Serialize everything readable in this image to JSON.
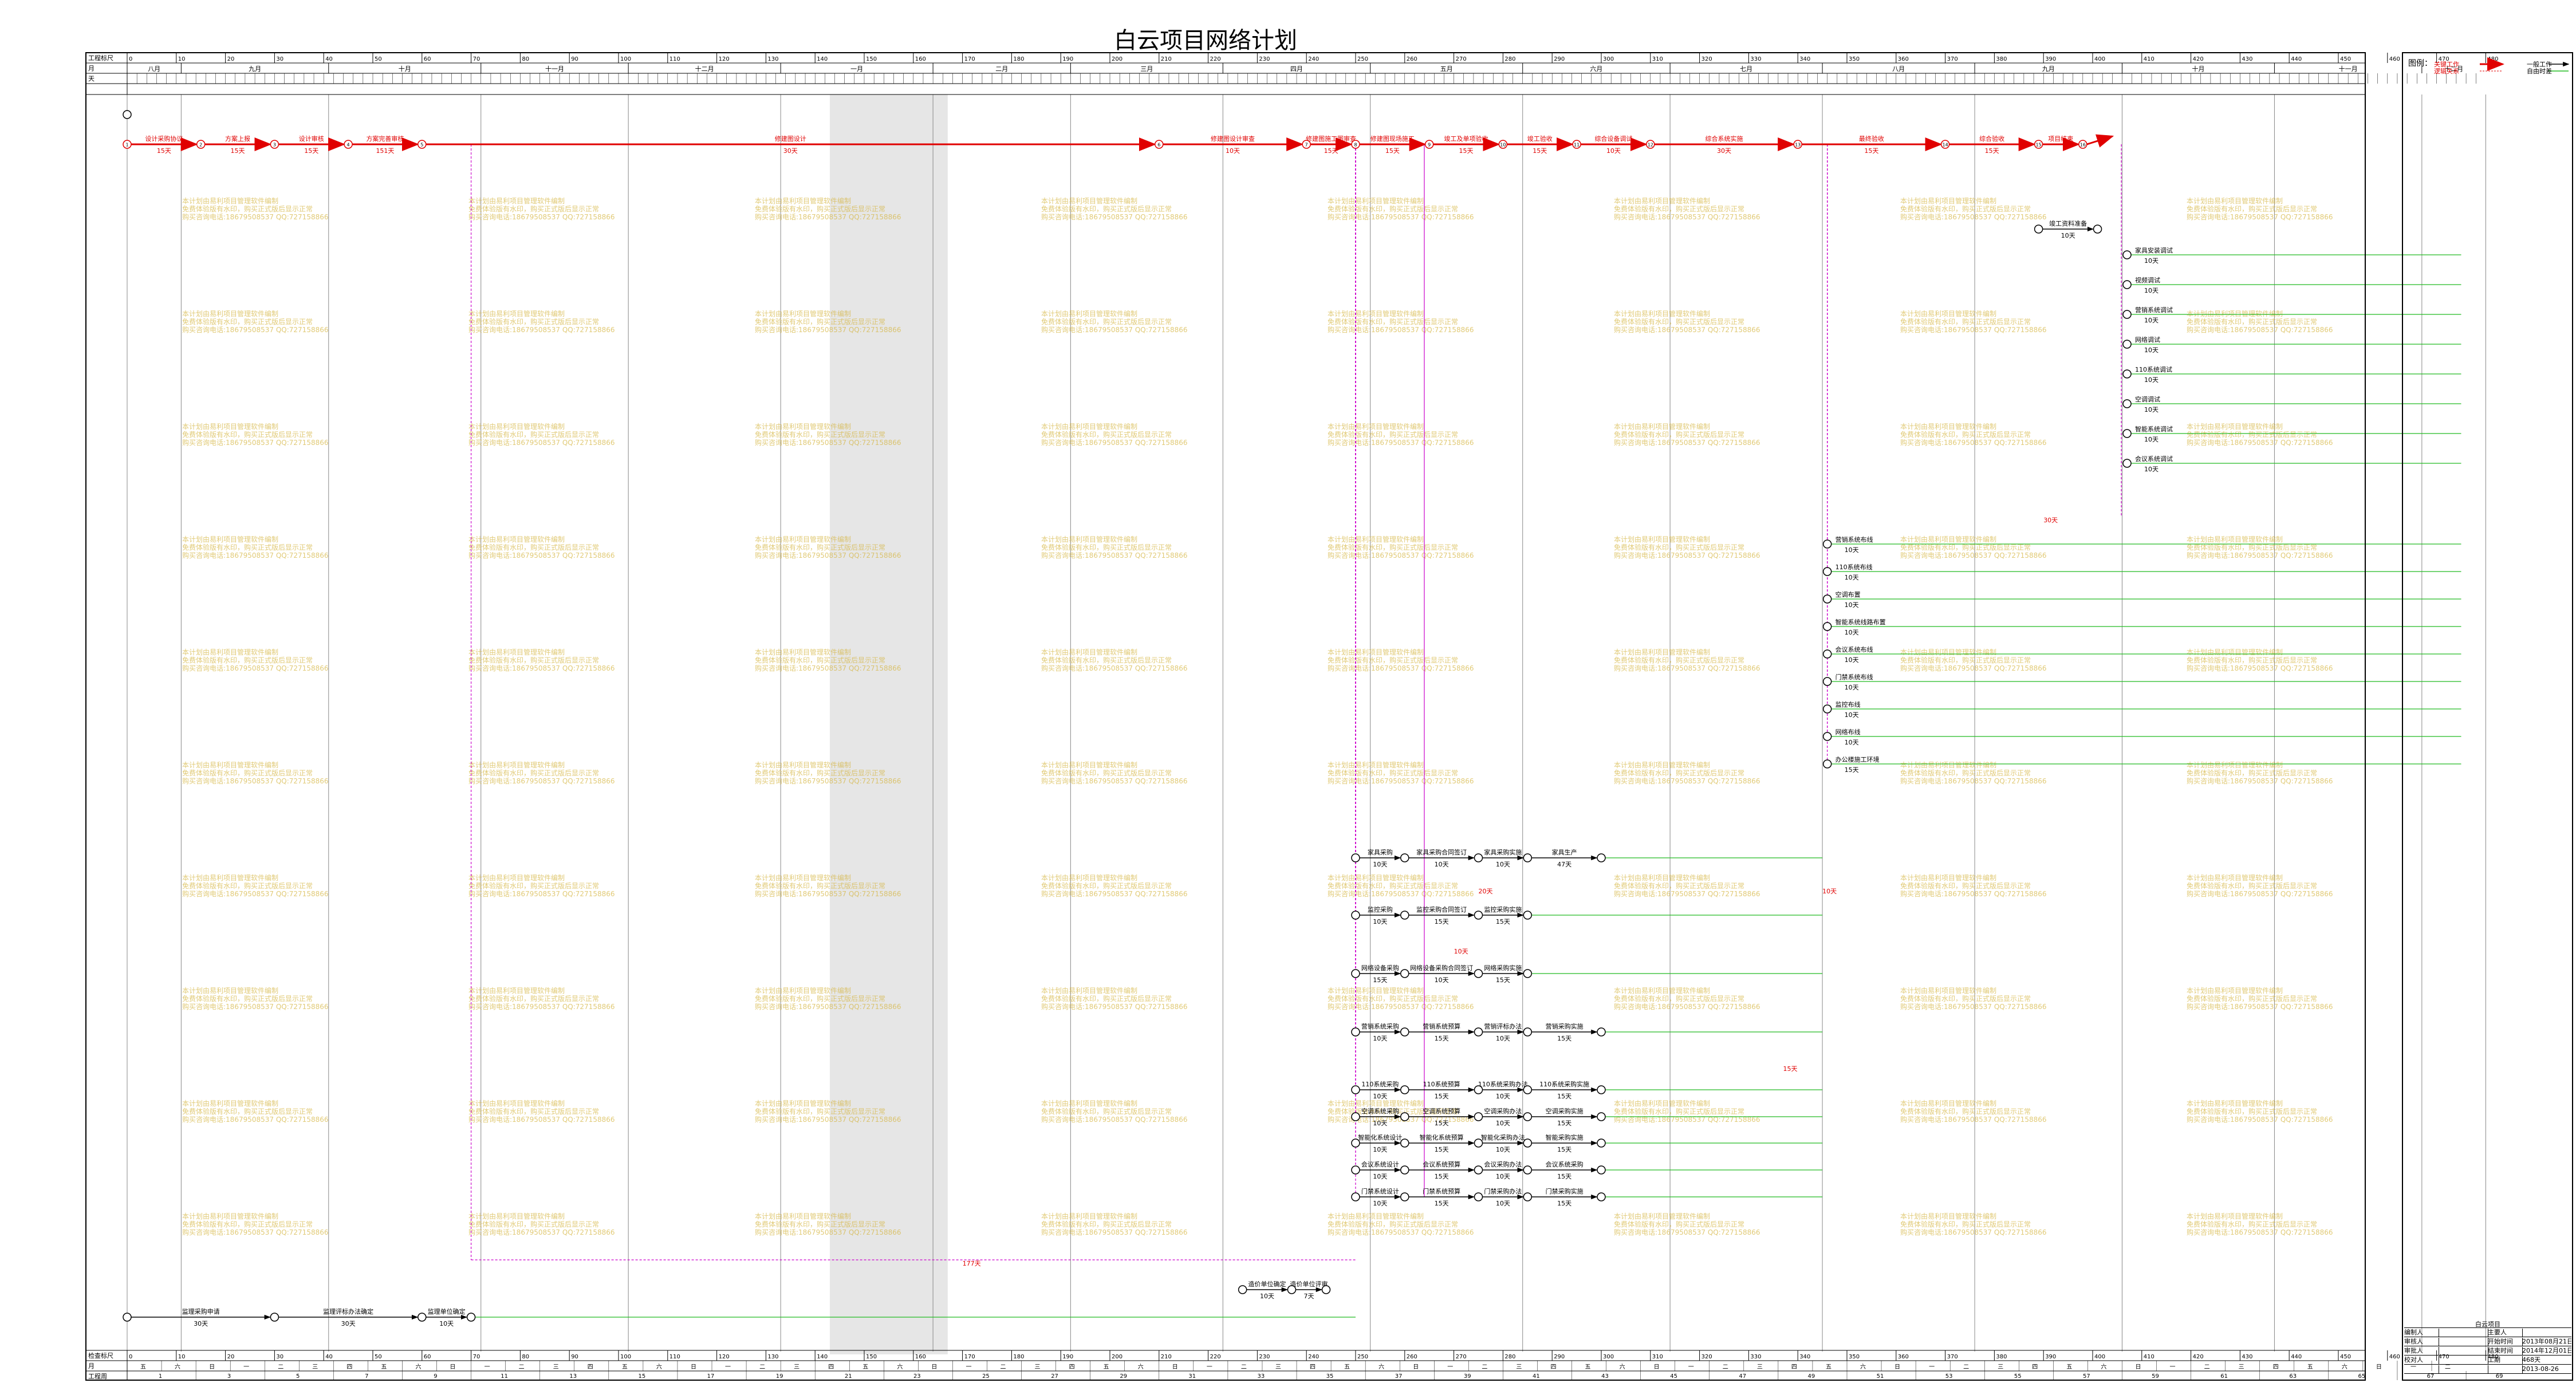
{
  "title": "白云项目网络计划",
  "timescale": {
    "header_labels": [
      "工程标尺",
      "月",
      "天"
    ],
    "footer_labels": [
      "检查标尺",
      "月",
      "工程周"
    ],
    "ruler_ticks": [
      0,
      10,
      20,
      30,
      40,
      50,
      60,
      70,
      80,
      90,
      100,
      110,
      120,
      130,
      140,
      150,
      160,
      170,
      180,
      190,
      200,
      210,
      220,
      230,
      240,
      250,
      260,
      270,
      280,
      290,
      300,
      310,
      320,
      330,
      340,
      350,
      360,
      370,
      380,
      390,
      400,
      410,
      420,
      430,
      440,
      450,
      460,
      470,
      480
    ],
    "months": [
      "八月",
      "九月",
      "十月",
      "十一月",
      "十二月",
      "一月",
      "二月",
      "三月",
      "四月",
      "五月",
      "六月",
      "七月",
      "八月",
      "九月",
      "十月",
      "十一月",
      "十二月"
    ],
    "week_numbers": [
      1,
      3,
      5,
      7,
      9,
      11,
      13,
      15,
      17,
      19,
      21,
      23,
      25,
      27,
      29,
      31,
      33,
      35,
      37,
      39,
      41,
      43,
      45,
      47,
      49,
      51,
      53,
      55,
      57,
      59,
      61,
      63,
      65,
      67,
      69
    ],
    "weekdays_footer": [
      "五",
      "六",
      "日",
      "一",
      "二",
      "三",
      "四"
    ]
  },
  "legend": {
    "title": "图例：",
    "critical": "关键工作",
    "logic": "逻辑关系",
    "noncritical": "一般工作",
    "float": "自由时差"
  },
  "colors": {
    "critical": "#e00000",
    "normal": "#000000",
    "float": "#22bb22",
    "dummy": "#cc00cc",
    "holiday": "#e6e6e6",
    "watermark": "#d4b43c"
  },
  "watermark": {
    "line1": "本计划由易利项目管理软件编制",
    "line2": "免费体验版有水印，购买正式版后显示正常",
    "line3": "购买咨询电话:18679508537 QQ:727158866"
  },
  "info_block": {
    "project": "白云项目",
    "rows": [
      [
        "编制人",
        "",
        "主要人",
        ""
      ],
      [
        "审核人",
        "",
        "开始时间",
        "2013年08月21日"
      ],
      [
        "审批人",
        "",
        "结束时间",
        "2014年12月01日"
      ],
      [
        "校对人",
        "",
        "工期",
        "468天"
      ],
      [
        "",
        "",
        "",
        "2013-08-26"
      ]
    ]
  },
  "critical_tasks": [
    {
      "name": "设计采购协议",
      "dur": "15天"
    },
    {
      "name": "方案上报",
      "dur": "15天"
    },
    {
      "name": "设计审核",
      "dur": "15天"
    },
    {
      "name": "方案完善审核",
      "dur": "151天"
    },
    {
      "name": "修建图设计",
      "dur": "30天"
    },
    {
      "name": "修建图设计审查",
      "dur": "10天"
    },
    {
      "name": "修建图施工图审查",
      "dur": "15天"
    },
    {
      "name": "修建图现场施工",
      "dur": "15天"
    },
    {
      "name": "竣工及单项验收",
      "dur": "15天"
    },
    {
      "name": "竣工验收",
      "dur": "15天"
    },
    {
      "name": "综合设备调试",
      "dur": "10天"
    },
    {
      "name": "综合系统实施",
      "dur": "30天"
    },
    {
      "name": "最终验收",
      "dur": "15天"
    },
    {
      "name": "综合验收",
      "dur": "15天"
    },
    {
      "name": "项目结束",
      "dur": ""
    }
  ],
  "purchase_tasks": [
    {
      "name": "家具采购",
      "dur": "10天"
    },
    {
      "name": "家具采购合同签订",
      "dur": "10天"
    },
    {
      "name": "家具采购实施",
      "dur": "10天"
    },
    {
      "name": "家具生产",
      "dur": "47天"
    },
    {
      "name": "监控采购",
      "dur": "10天"
    },
    {
      "name": "监控采购合同签订",
      "dur": "15天"
    },
    {
      "name": "监控采购实施",
      "dur": "15天"
    },
    {
      "name": "网络设备采购",
      "dur": "15天"
    },
    {
      "name": "网络设备采购合同签订",
      "dur": "10天"
    },
    {
      "name": "网络采购实施",
      "dur": "15天"
    },
    {
      "name": "营销系统采购",
      "dur": "10天"
    },
    {
      "name": "营销系统预算",
      "dur": "15天"
    },
    {
      "name": "营销评标办法",
      "dur": "10天"
    },
    {
      "name": "营销采购实施",
      "dur": "15天"
    },
    {
      "name": "110系统采购",
      "dur": "10天"
    },
    {
      "name": "110系统预算",
      "dur": "15天"
    },
    {
      "name": "110系统采购办法",
      "dur": "10天"
    },
    {
      "name": "110系统采购实施",
      "dur": "15天"
    },
    {
      "name": "空调系统采购",
      "dur": "10天"
    },
    {
      "name": "空调系统预算",
      "dur": "15天"
    },
    {
      "name": "空调采购办法",
      "dur": "10天"
    },
    {
      "name": "空调采购实施",
      "dur": "15天"
    },
    {
      "name": "智能化系统设计",
      "dur": "10天"
    },
    {
      "name": "智能化系统预算",
      "dur": "15天"
    },
    {
      "name": "智能化采购办法",
      "dur": "10天"
    },
    {
      "name": "智能采购实施",
      "dur": "15天"
    },
    {
      "name": "会议系统设计",
      "dur": "10天"
    },
    {
      "name": "会议系统预算",
      "dur": "15天"
    },
    {
      "name": "会议采购办法",
      "dur": "10天"
    },
    {
      "name": "会议系统采购",
      "dur": "15天"
    },
    {
      "name": "门禁系统设计",
      "dur": "10天"
    },
    {
      "name": "门禁系统预算",
      "dur": "15天"
    },
    {
      "name": "门禁采购办法",
      "dur": "10天"
    },
    {
      "name": "门禁采购实施",
      "dur": "15天"
    }
  ],
  "install_tasks": [
    {
      "name": "营销系统布线",
      "dur": "10天"
    },
    {
      "name": "110系统布线",
      "dur": "10天"
    },
    {
      "name": "空调布置",
      "dur": "10天"
    },
    {
      "name": "智能系统线路布置",
      "dur": "10天"
    },
    {
      "name": "会议系统布线",
      "dur": "10天"
    },
    {
      "name": "门禁系统布线",
      "dur": "10天"
    },
    {
      "name": "监控布线",
      "dur": "10天"
    },
    {
      "name": "网络布线",
      "dur": "10天"
    },
    {
      "name": "办公楼施工环境",
      "dur": "15天"
    }
  ],
  "test_tasks": [
    {
      "name": "家具安装调试",
      "dur": "10天"
    },
    {
      "name": "视频调试",
      "dur": "10天"
    },
    {
      "name": "营销系统调试",
      "dur": "10天"
    },
    {
      "name": "网络调试",
      "dur": "10天"
    },
    {
      "name": "110系统调试",
      "dur": "10天"
    },
    {
      "name": "空调调试",
      "dur": "10天"
    },
    {
      "name": "智能系统调试",
      "dur": "10天"
    },
    {
      "name": "会议系统调试",
      "dur": "10天"
    }
  ],
  "misc_tasks": [
    {
      "name": "监理采购申请",
      "dur": "30天"
    },
    {
      "name": "监理评标办法确定",
      "dur": "30天"
    },
    {
      "name": "监理单位确定",
      "dur": "10天"
    },
    {
      "name": "造价单位确定",
      "dur": "10天"
    },
    {
      "name": "造价单位评审",
      "dur": "7天"
    },
    {
      "name": "竣工资料准备",
      "dur": "10天"
    }
  ],
  "float_labels": [
    "177天",
    "20天",
    "10天",
    "15天",
    "10天",
    "30天"
  ]
}
